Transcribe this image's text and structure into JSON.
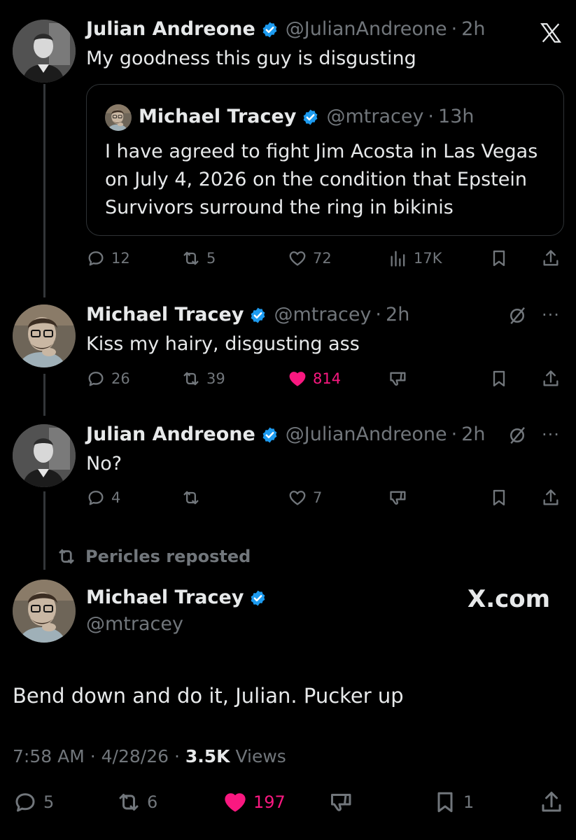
{
  "colors": {
    "background": "#000000",
    "text": "#e7e9ea",
    "muted": "#71767b",
    "verified": "#1d9bf0",
    "like": "#f91880",
    "border": "#2f3336"
  },
  "top_icon": "x-logo-icon",
  "tweets": [
    {
      "author": "Julian Andreone",
      "handle": "@JulianAndreone",
      "time": "2h",
      "text": "My goodness this guy is disgusting",
      "quote": {
        "author": "Michael Tracey",
        "handle": "@mtracey",
        "time": "13h",
        "lines": [
          "I have agreed to fight Jim Acosta in Las Vegas",
          "on July 4, 2026 on the condition that Epstein",
          "Survivors surround the ring in bikinis"
        ]
      },
      "actions": {
        "replies": "12",
        "reposts": "5",
        "likes": "72",
        "views": "17K"
      }
    },
    {
      "author": "Michael Tracey",
      "handle": "@mtracey",
      "time": "2h",
      "text": "Kiss my hairy, disgusting ass",
      "actions": {
        "replies": "26",
        "reposts": "39",
        "likes": "814",
        "liked": true
      }
    },
    {
      "author": "Julian Andreone",
      "handle": "@JulianAndreone",
      "time": "2h",
      "text": "No?",
      "actions": {
        "replies": "4",
        "reposts": "",
        "likes": "7"
      }
    }
  ],
  "repost_label": "Pericles reposted",
  "main_tweet": {
    "author": "Michael Tracey",
    "handle": "@mtracey",
    "brand": "X.com",
    "text": "Bend down and do it, Julian. Pucker up",
    "time": "7:58 AM",
    "date": "4/28/26",
    "views_count": "3.5K",
    "views_label": "Views",
    "actions": {
      "replies": "5",
      "reposts": "6",
      "likes": "197",
      "bookmarks": "1",
      "liked": true
    }
  },
  "separator": "·"
}
